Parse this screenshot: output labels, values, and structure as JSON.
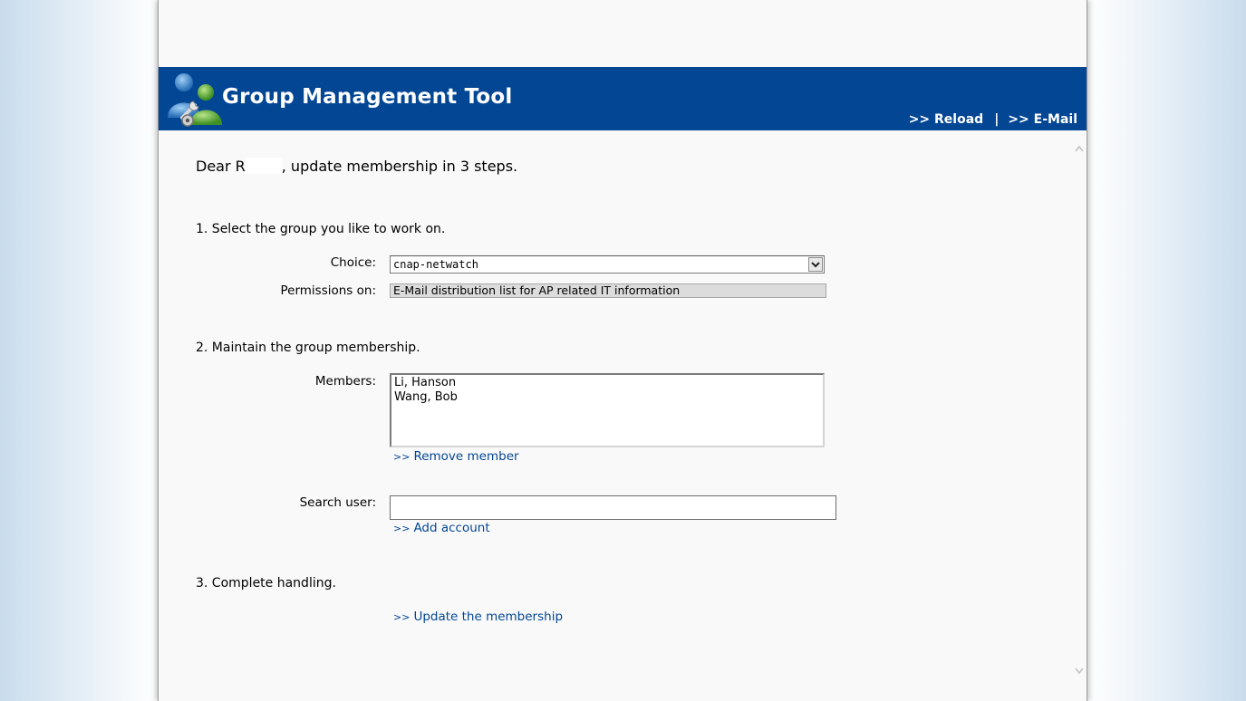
{
  "header": {
    "title": "Group Management Tool",
    "links": {
      "reload": ">> Reload",
      "separator": "|",
      "email": ">> E-Mail"
    },
    "logo_icon": "group-users-settings-icon"
  },
  "greeting": {
    "prefix": "Dear R",
    "suffix": ", update membership in 3 steps."
  },
  "step1": {
    "heading": "1. Select the group you like to work on.",
    "choice_label": "Choice:",
    "choice_value": "cnap-netwatch",
    "permissions_label": "Permissions on:",
    "permissions_value": "E-Mail distribution list for AP related IT information"
  },
  "step2": {
    "heading": "2. Maintain the group membership.",
    "members_label": "Members:",
    "members": [
      "Li, Hanson",
      "Wang, Bob"
    ],
    "remove_link": "Remove member",
    "search_label": "Search user:",
    "search_value": "",
    "add_link": "Add account"
  },
  "step3": {
    "heading": "3. Complete handling.",
    "update_link": "Update the membership"
  },
  "colors": {
    "header_bg": "#034694",
    "link": "#034694",
    "page_bg": "#f9f9f9"
  }
}
